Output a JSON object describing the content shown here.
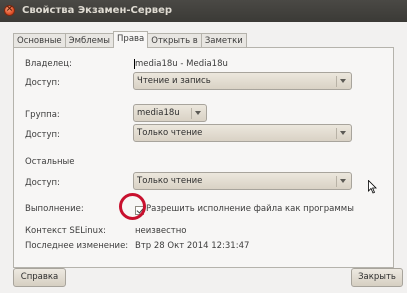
{
  "window": {
    "title": "Свойства Экзамен-Сервер"
  },
  "tabs": [
    {
      "label": "Основные"
    },
    {
      "label": "Эмблемы"
    },
    {
      "label": "Права"
    },
    {
      "label": "Открыть в"
    },
    {
      "label": "Заметки"
    }
  ],
  "active_tab": "Права",
  "permissions": {
    "owner": {
      "label": "Владелец:",
      "value": "media18u - Media18u"
    },
    "owner_access": {
      "label": "Доступ:",
      "value": "Чтение и запись"
    },
    "group": {
      "label": "Группа:",
      "value": "media18u"
    },
    "group_access": {
      "label": "Доступ:",
      "value": "Только чтение"
    },
    "others": {
      "label": "Остальные"
    },
    "others_access": {
      "label": "Доступ:",
      "value": "Только чтение"
    },
    "execute": {
      "label": "Выполнение:",
      "checkbox_label": "Разрешить исполнение файла как программы",
      "checked": true
    },
    "selinux": {
      "label": "Контекст SELinux:",
      "value": "неизвестно"
    },
    "modified": {
      "label": "Последнее изменение:",
      "value": "Втр 28 Окт 2014 12:31:47"
    }
  },
  "buttons": {
    "help": "Справка",
    "close": "Закрыть"
  },
  "colors": {
    "titlebar": "#3c3b37",
    "close_button": "#e0512a",
    "highlight_circle": "#c8102e"
  },
  "icons": [
    "close-icon",
    "chevron-down-icon",
    "mouse-pointer-icon",
    "check-icon"
  ]
}
